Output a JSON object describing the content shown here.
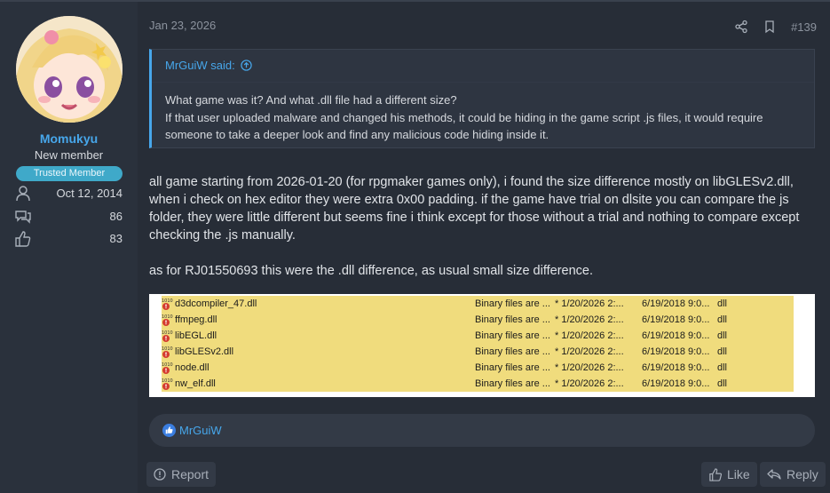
{
  "user": {
    "name": "Momukyu",
    "title": "New member",
    "badge": "Trusted Member",
    "joined": "Oct 12, 2014",
    "messages": "86",
    "reactions": "83"
  },
  "post": {
    "date": "Jan 23, 2026",
    "number": "#139",
    "quote": {
      "author": "MrGuiW said:",
      "lines": [
        "What game was it? And what .dll file had a different size?",
        "If that user uploaded malware and changed his methods, it could be hiding in the game script .js files, it would require someone to take a deeper look and find any malicious code hiding inside it."
      ]
    },
    "paragraphs": [
      "all game starting from 2026-01-20 (for rpgmaker games only), i found the size difference mostly on libGLESv2.dll, when i check on hex editor they were extra 0x00 padding. if the game have trial on dlsite you can compare the js folder, they were little different but seems fine i think except for those without a trial and nothing to compare except checking the .js manually.",
      "as for RJ01550693 this were the .dll difference, as usual small size difference."
    ],
    "files": [
      {
        "name": "d3dcompiler_47.dll",
        "desc": "Binary files are ...",
        "date1": "* 1/20/2026 2:...",
        "date2": "6/19/2018 9:0...",
        "ext": "dll"
      },
      {
        "name": "ffmpeg.dll",
        "desc": "Binary files are ...",
        "date1": "* 1/20/2026 2:...",
        "date2": "6/19/2018 9:0...",
        "ext": "dll"
      },
      {
        "name": "libEGL.dll",
        "desc": "Binary files are ...",
        "date1": "* 1/20/2026 2:...",
        "date2": "6/19/2018 9:0...",
        "ext": "dll"
      },
      {
        "name": "libGLESv2.dll",
        "desc": "Binary files are ...",
        "date1": "* 1/20/2026 2:...",
        "date2": "6/19/2018 9:0...",
        "ext": "dll"
      },
      {
        "name": "node.dll",
        "desc": "Binary files are ...",
        "date1": "* 1/20/2026 2:...",
        "date2": "6/19/2018 9:0...",
        "ext": "dll"
      },
      {
        "name": "nw_elf.dll",
        "desc": "Binary files are ...",
        "date1": "* 1/20/2026 2:...",
        "date2": "6/19/2018 9:0...",
        "ext": "dll"
      }
    ],
    "reaction_names": "MrGuiW"
  },
  "buttons": {
    "report": "Report",
    "like": "Like",
    "reply": "Reply"
  },
  "icons": {
    "joined": "user-icon",
    "messages": "chat-icon",
    "reactions": "thumbs-up-icon",
    "share": "share-icon",
    "bookmark": "bookmark-icon",
    "quote_jump": "arrow-up-circle-icon",
    "file": "binary-diff-file-icon",
    "report": "report-icon",
    "like": "like-icon",
    "reply": "reply-icon"
  },
  "colors": {
    "accent": "#47a7eb",
    "badge": "#3fa9c9",
    "highlight_row": "#f0dc7d"
  }
}
